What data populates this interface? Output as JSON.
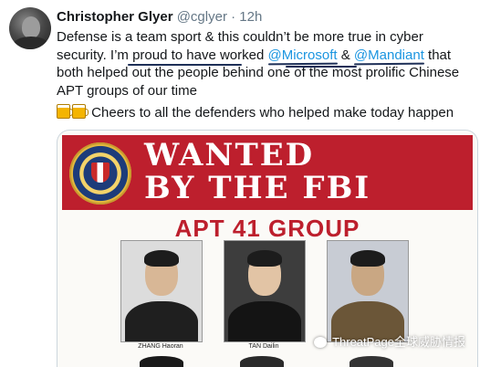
{
  "author": {
    "name": "Christopher Glyer",
    "handle": "@cglyer",
    "separator": "·",
    "time": "12h"
  },
  "tweet": {
    "line_start": "Defense is a team sport & this couldn’t be more true in cyber security. I’m proud to have worked ",
    "mention_1": "@Microsoft",
    "mid": " & ",
    "mention_2": "@Mandiant",
    "line_end": " that both helped out the people behind one of the most prolific Chinese APT groups of our time",
    "cheers": "Cheers to all the defenders who helped make today happen"
  },
  "poster": {
    "headline": "WANTED",
    "headline_2": "BY THE FBI",
    "group": "APT 41 GROUP",
    "caption_1": "ZHANG Haoran",
    "caption_2": "TAN Dailin"
  },
  "watermark": {
    "text": "ThreatPage全球威胁情报"
  },
  "colors": {
    "banner_red": "#bd1f2d",
    "link_blue": "#1b95e0"
  },
  "icons": [
    "avatar",
    "beer-mug-icon",
    "fbi-seal",
    "wechat-icon"
  ]
}
